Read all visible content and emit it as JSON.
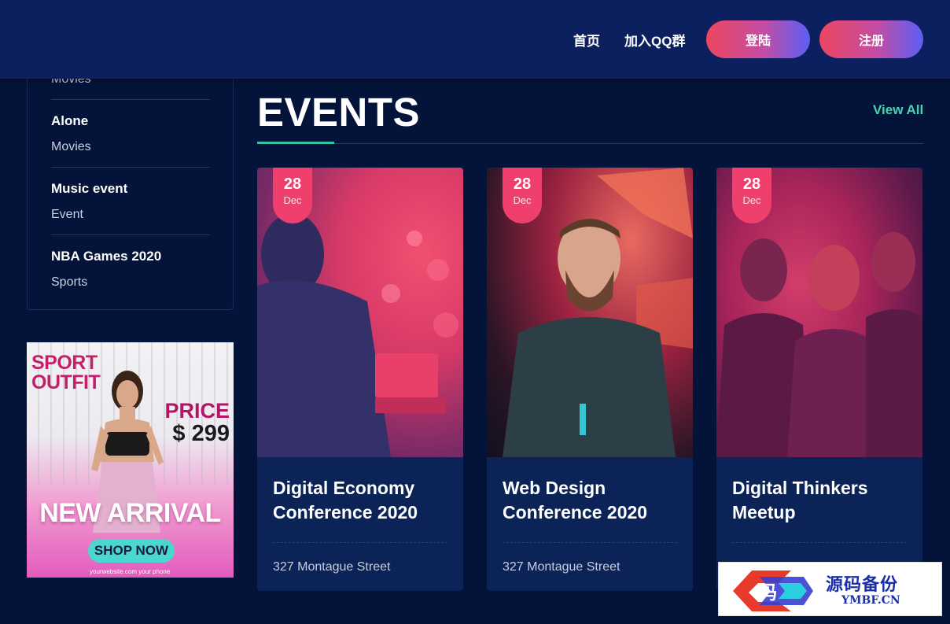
{
  "header": {
    "nav": {
      "home": "首页",
      "qq_group": "加入QQ群"
    },
    "login_label": "登陆",
    "register_label": "注册"
  },
  "sidebar": {
    "top_category": "Movies",
    "items": [
      {
        "title": "Alone",
        "category": "Movies"
      },
      {
        "title": "Music event",
        "category": "Event"
      },
      {
        "title": "NBA Games 2020",
        "category": "Sports"
      }
    ]
  },
  "ad": {
    "line1": "SPORT",
    "line2": "OUTFIT",
    "price_label": "PRICE",
    "price_value": "$ 299",
    "headline": "NEW ARRIVAL",
    "cta": "SHOP NOW",
    "footer": "yourwebsite.com    your phone"
  },
  "events": {
    "heading": "EVENTS",
    "view_all": "View All",
    "cards": [
      {
        "day": "28",
        "month": "Dec",
        "title": "Digital Economy Conference 2020",
        "address": "327 Montague Street"
      },
      {
        "day": "28",
        "month": "Dec",
        "title": "Web Design Conference 2020",
        "address": "327 Montague Street"
      },
      {
        "day": "28",
        "month": "Dec",
        "title": "Digital Thinkers Meetup",
        "address": ""
      }
    ]
  },
  "watermark": {
    "cn": "源码备份",
    "en": "YMBF.CN"
  },
  "colors": {
    "header_bg": "#0c1f5e",
    "page_bg": "#04133a",
    "accent_teal": "#34c5a6",
    "badge_pink": "#ee3f6d"
  }
}
